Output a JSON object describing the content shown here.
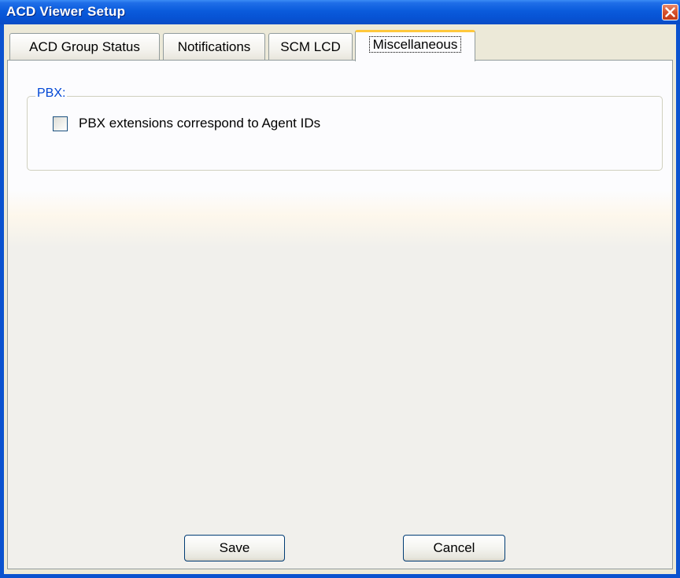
{
  "window": {
    "title": "ACD Viewer Setup"
  },
  "tabs": [
    {
      "label": "ACD Group Status",
      "active": false
    },
    {
      "label": "Notifications",
      "active": false
    },
    {
      "label": "SCM LCD",
      "active": false
    },
    {
      "label": "Miscellaneous",
      "active": true
    }
  ],
  "pbx_group": {
    "legend": "PBX:",
    "checkbox_label": "PBX extensions correspond to Agent IDs",
    "checked": false
  },
  "buttons": {
    "save_label": "Save",
    "cancel_label": "Cancel"
  },
  "colors": {
    "titlebar": "#0a5bdc",
    "legend_text": "#0046d5",
    "active_tab_accent": "#ffc83c",
    "close_button": "#d6512c"
  },
  "icons": {
    "close": "close-icon"
  }
}
